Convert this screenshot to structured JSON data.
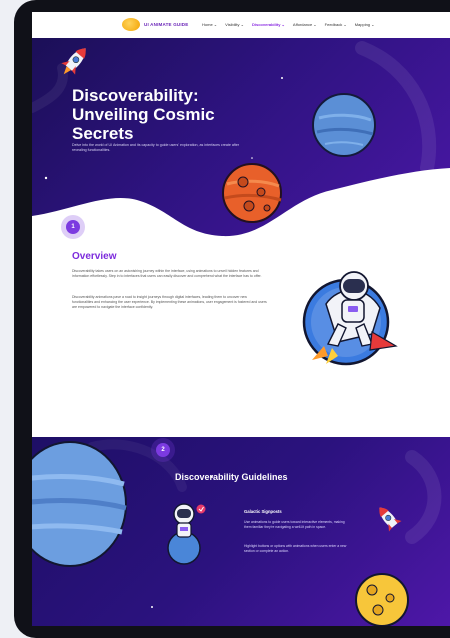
{
  "nav": {
    "logo_text": "UI ANIMATE GUIDE",
    "items": [
      {
        "label": "Home ⌄",
        "active": false
      },
      {
        "label": "Visibility ⌄",
        "active": false
      },
      {
        "label": "Discoverability ⌄",
        "active": true
      },
      {
        "label": "Affordance ⌄",
        "active": false
      },
      {
        "label": "Feedback ⌄",
        "active": false
      },
      {
        "label": "Mapping ⌄",
        "active": false
      }
    ]
  },
  "hero": {
    "title": "Discoverability: Unveiling Cosmic Secrets",
    "subtitle": "Delve into the world of UI Animation and its capacity to guide users' exploration, as interfaces create after revealing functionalities."
  },
  "overview": {
    "step": "1",
    "title": "Overview",
    "paragraphs": [
      "Discoverability takes users on an astonishing journey within the interface, using animations to unveil hidden features and information effortlessly. Step in to interfaces that users can easily discover and comprehend what the interface has to offer.",
      "Discoverability animations pave a road to insight journeys through digital interfaces, leading them to uncover new functionalities and enhancing the user experience. By implementing these animations, user engagement is fostered and users are empowered to navigate the interface confidently."
    ]
  },
  "guidelines": {
    "step": "2",
    "title": "Discoverability Guidelines",
    "item_title": "Galactic Signposts",
    "item_paragraphs": [
      "Use animations to guide users toward interactive elements, making them familiar they're navigating a well-lit path in space.",
      "Highlight buttons or options with animations when users enter a new section or complete an action."
    ]
  },
  "colors": {
    "accent": "#7c2bdc",
    "hero_dark": "#1b0f57",
    "hero_light": "#4a17a6"
  }
}
